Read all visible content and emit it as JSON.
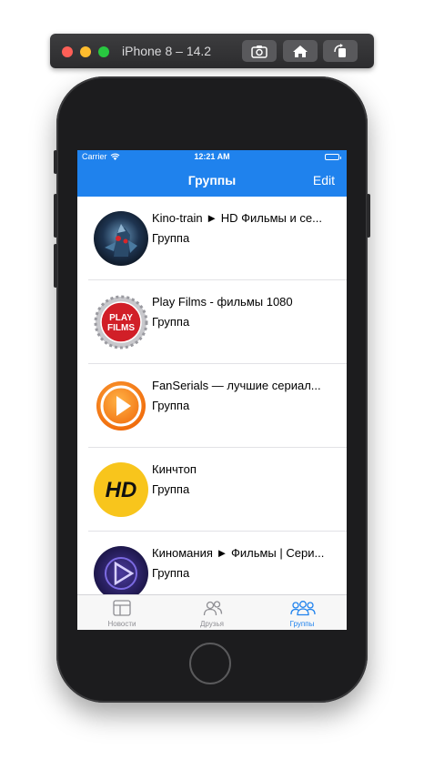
{
  "simulator": {
    "title": "iPhone 8 – 14.2"
  },
  "status_bar": {
    "carrier": "Carrier",
    "time": "12:21 AM"
  },
  "nav": {
    "title": "Группы",
    "edit_label": "Edit"
  },
  "groups": [
    {
      "title": "Kino-train ► HD Фильмы и се...",
      "subtitle": "Группа",
      "avatar": "kino-train-avatar"
    },
    {
      "title": "Play Films - фильмы 1080",
      "subtitle": "Группа",
      "avatar": "play-films-avatar",
      "avatar_text": [
        "PLAY",
        "FILMS"
      ]
    },
    {
      "title": "FanSerials — лучшие сериал...",
      "subtitle": "Группа",
      "avatar": "fanserials-avatar"
    },
    {
      "title": "Кинчтоп",
      "subtitle": "Группа",
      "avatar": "hd-avatar",
      "avatar_text": "HD"
    },
    {
      "title": "Киномания ► Фильмы | Сери...",
      "subtitle": "Группа",
      "avatar": "kinomania-avatar"
    }
  ],
  "tabs": [
    {
      "label": "Новости",
      "icon": "news-icon",
      "active": false
    },
    {
      "label": "Друзья",
      "icon": "friends-icon",
      "active": false
    },
    {
      "label": "Группы",
      "icon": "groups-icon",
      "active": true
    }
  ],
  "colors": {
    "accent": "#1f82ed",
    "inactive_tab": "#8e8e93"
  }
}
